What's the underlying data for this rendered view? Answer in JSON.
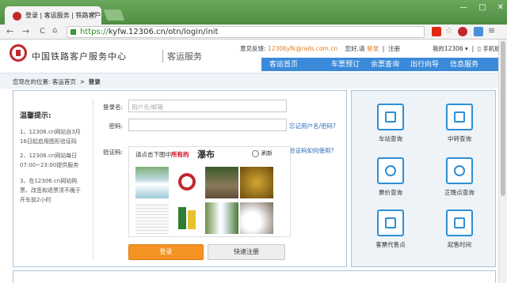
{
  "browser": {
    "tab_title": "登录 | 客运服务 | 铁路客户",
    "tab_close": "×",
    "url_scheme": "https://",
    "url_rest": "kyfw.12306.cn/otn/login/init",
    "window_controls": [
      "—",
      "□",
      "✕"
    ],
    "nav": {
      "back": "←",
      "forward": "→",
      "reload": "C"
    }
  },
  "header": {
    "site_title": "中国铁路客户服务中心",
    "site_sub": "客运服务",
    "feedback_label": "意见反馈:",
    "feedback_email": "12306yfk@rails.com.cn",
    "greeting": "您好,请",
    "login_link": "登录",
    "register_link": "注册",
    "my12306": "我的12306",
    "mobile": "手机版"
  },
  "menu": [
    "客运首页",
    "车票预订",
    "余票查询",
    "出行向导",
    "信息服务"
  ],
  "crumb": {
    "label": "您现在的位置:",
    "home": "客运首页",
    "sep": ">",
    "current": "登录"
  },
  "tips": {
    "title": "温馨提示:",
    "items": [
      "1、12306.cn网站自3月16日起启用图形验证码",
      "2、12306.cn网站每日07:00~23:00提供服务",
      "3、在12306.cn网站购票、改签和退票须不晚于开车前2小时"
    ]
  },
  "form": {
    "username_label": "登录名:",
    "username_placeholder": "用户名/邮箱",
    "password_label": "密码:",
    "forgot": "忘记用户名/密码?",
    "captcha_label": "验证码:",
    "captcha_help": "验证码如何使用?",
    "captcha_prompt_pre": "请点击下图中",
    "captcha_prompt_red": "所有的",
    "captcha_word": "瀑布",
    "refresh": "刷新",
    "login_button": "登录",
    "register_button": "快速注册"
  },
  "services": [
    {
      "label": "车站查询",
      "icon": "station-icon"
    },
    {
      "label": "中转查询",
      "icon": "transfer-icon"
    },
    {
      "label": "票价查询",
      "icon": "fare-icon"
    },
    {
      "label": "正晚点查询",
      "icon": "clock-icon"
    },
    {
      "label": "客票代售点",
      "icon": "agency-icon"
    },
    {
      "label": "起售时间",
      "icon": "calendar-icon"
    }
  ],
  "colors": {
    "menu_blue": "#3b8ad9",
    "orange": "#f49323",
    "brand_red": "#c1272d",
    "icon_blue": "#2d8fd5"
  }
}
